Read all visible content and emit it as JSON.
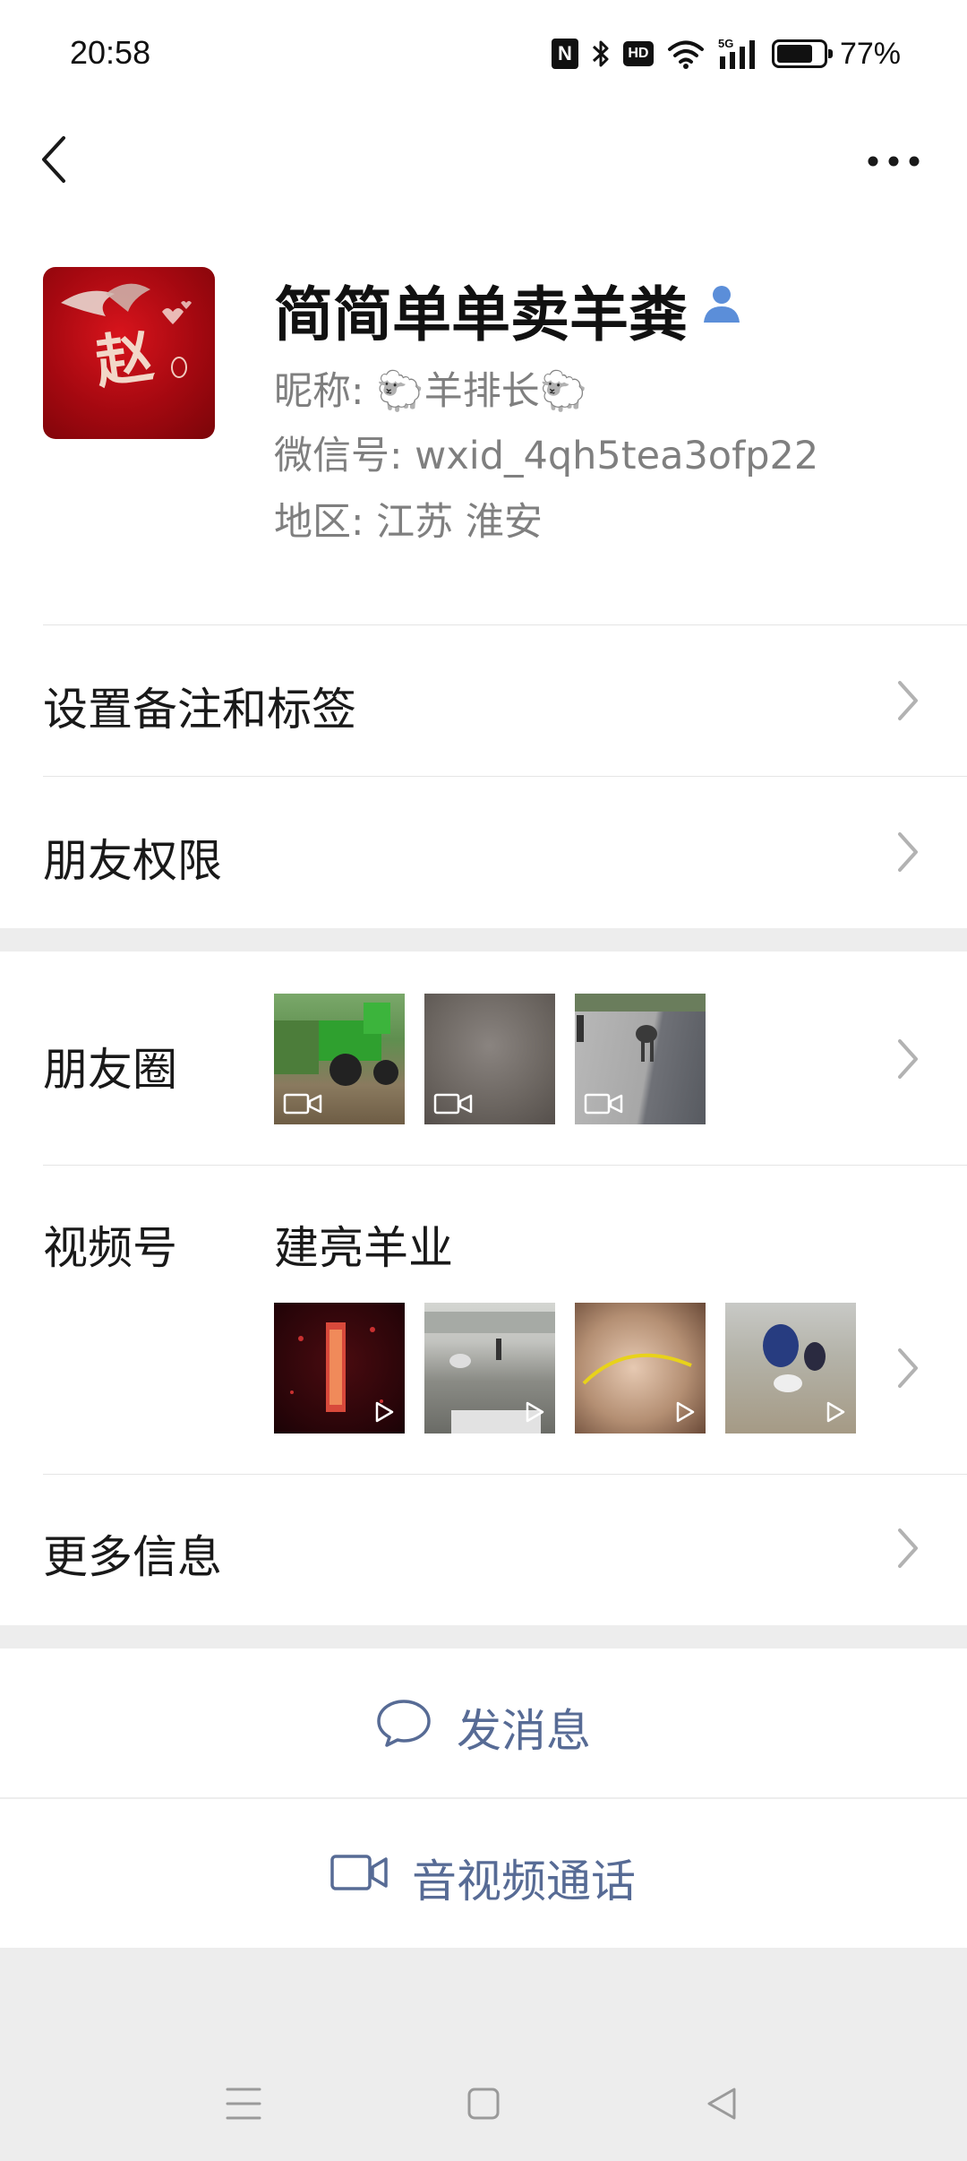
{
  "status_bar": {
    "time": "20:58",
    "nfc_label": "N",
    "hd_label": "HD",
    "network_label": "5G",
    "battery_percent": 77,
    "battery_text": "77%"
  },
  "nav": {
    "back_icon": "chevron-left-icon",
    "more_icon": "more-dots-icon"
  },
  "profile": {
    "avatar_char": "赵",
    "display_name": "简简单单卖羊粪",
    "nickname_line": "昵称: 🐑羊排长🐑",
    "wechat_id_line": "微信号: wxid_4qh5tea3ofp22",
    "region_line": "地区: 江苏  淮安"
  },
  "rows": {
    "remark_tags": "设置备注和标签",
    "friend_permissions": "朋友权限",
    "moments": "朋友圈",
    "channels": "视频号",
    "channels_name": "建亮羊业",
    "more_info": "更多信息"
  },
  "actions": {
    "send_message": "发消息",
    "av_call": "音视频通话"
  },
  "colors": {
    "link_blue": "#576b95",
    "verified_blue": "#5b8ed9",
    "divider": "#e5e5e5",
    "background": "#ededed"
  }
}
